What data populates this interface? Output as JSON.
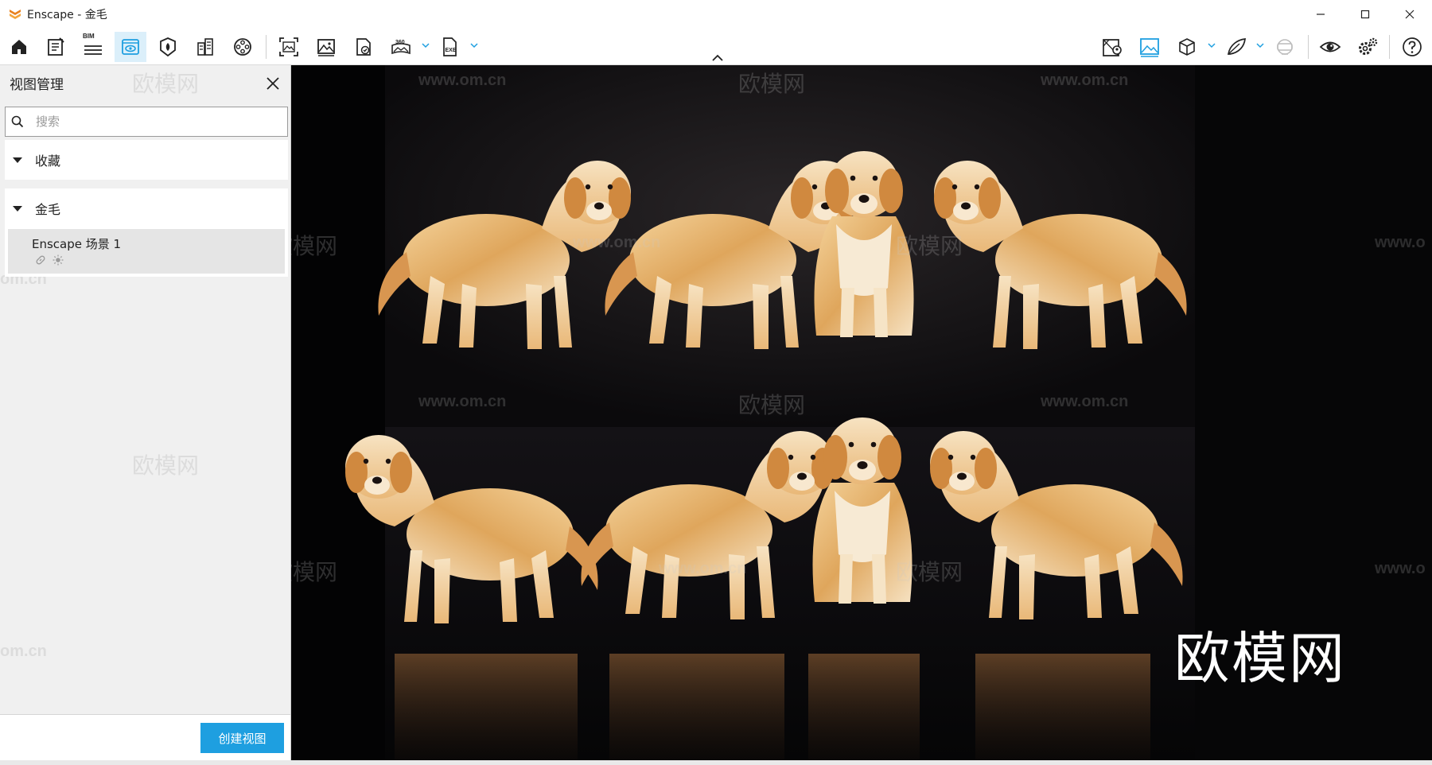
{
  "window": {
    "title": "Enscape - 金毛",
    "brand_color": "#e8811f"
  },
  "toolbar": {
    "bim_label": "BIM",
    "left_icons": [
      "home-icon",
      "notes-icon",
      "bim-icon",
      "visual-settings-icon",
      "asset-library-icon",
      "site-context-icon",
      "video-editor-icon",
      "batch-render-icon",
      "screenshot-icon",
      "panorama-icon",
      "export-exe-icon"
    ],
    "right_icons": [
      "map-icon",
      "render-mode-icon",
      "cube-icon",
      "leaf-icon",
      "vr-headset-icon",
      "view-icon",
      "settings-icon",
      "help-icon"
    ],
    "accent": "#1e9fe0"
  },
  "panel": {
    "title": "视图管理",
    "search_placeholder": "搜索",
    "groups": [
      {
        "label": "收藏",
        "items": []
      },
      {
        "label": "金毛",
        "items": [
          {
            "name": "Enscape 场景 1"
          }
        ]
      }
    ],
    "create_label": "创建视图"
  },
  "viewport": {
    "watermark_big": "欧模网",
    "watermark_brand": "欧模网",
    "watermark_url": "www.om.cn",
    "watermark_url_fragment": "om.cn",
    "watermark_url_partial": "www.o",
    "watermark_url_cut": "www.om.cn"
  }
}
